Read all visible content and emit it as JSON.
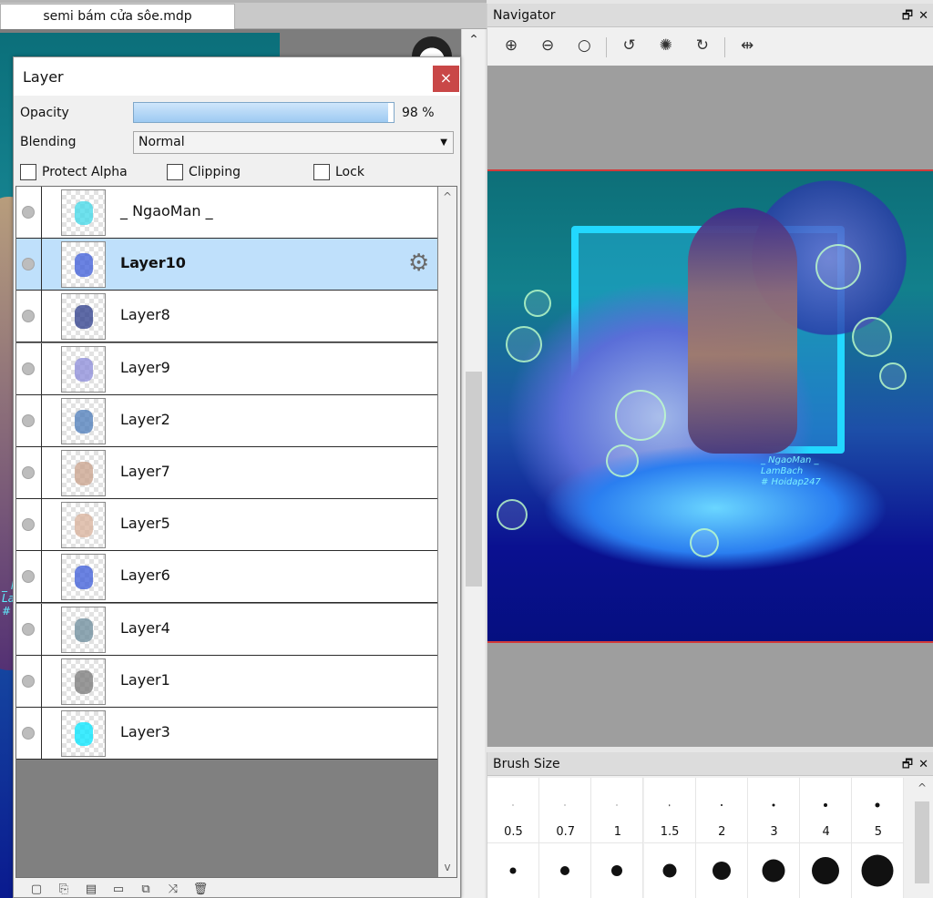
{
  "file_tab": {
    "title": "semi bám cửa sôe.mdp"
  },
  "canvas": {
    "signature": "_ NgaoMan _\nLamBach\n# Hoidap247"
  },
  "layer_panel": {
    "title": "Layer",
    "close_glyph": "×",
    "opacity_label": "Opacity",
    "opacity_value": "98 %",
    "opacity_fraction": 0.98,
    "blending_label": "Blending",
    "blending_value": "Normal",
    "checkboxes": {
      "protect_alpha": "Protect Alpha",
      "clipping": "Clipping",
      "lock": "Lock"
    },
    "layers": [
      {
        "name": "_ NgaoMan _",
        "selected": false,
        "thumb_color": "#3fd8e8"
      },
      {
        "name": "Layer10",
        "selected": true,
        "thumb_color": "#3a5ad8"
      },
      {
        "name": "Layer8",
        "selected": false,
        "thumb_color": "#2a3a8a"
      },
      {
        "name": "Layer9",
        "selected": false,
        "thumb_color": "#8a8ad8"
      },
      {
        "name": "Layer2",
        "selected": false,
        "thumb_color": "#4a7ab8"
      },
      {
        "name": "Layer7",
        "selected": false,
        "thumb_color": "#c8a08a"
      },
      {
        "name": "Layer5",
        "selected": false,
        "thumb_color": "#d8b09a"
      },
      {
        "name": "Layer6",
        "selected": false,
        "thumb_color": "#3a5ad8"
      },
      {
        "name": "Layer4",
        "selected": false,
        "thumb_color": "#6a8a9a"
      },
      {
        "name": "Layer1",
        "selected": false,
        "thumb_color": "#777777"
      },
      {
        "name": "Layer3",
        "selected": false,
        "thumb_color": "#00e5ff"
      }
    ],
    "toolbar_icons": [
      "new-layer-icon",
      "duplicate-layer-icon",
      "new-halftone-layer-icon",
      "new-folder-icon",
      "merge-down-icon",
      "transform-icon",
      "delete-layer-icon"
    ]
  },
  "navigator": {
    "title": "Navigator",
    "toolbar_icons": [
      "zoom-in-icon",
      "zoom-out-icon",
      "zoom-actual-icon",
      "rotate-left-icon",
      "rotate-reset-icon",
      "rotate-right-icon",
      "flip-horizontal-icon"
    ]
  },
  "brush_size": {
    "title": "Brush Size",
    "sizes": [
      {
        "label": "0.5",
        "dot": 0
      },
      {
        "label": "0.7",
        "dot": 0
      },
      {
        "label": "1",
        "dot": 1
      },
      {
        "label": "1.5",
        "dot": 1.5
      },
      {
        "label": "2",
        "dot": 2
      },
      {
        "label": "3",
        "dot": 3
      },
      {
        "label": "4",
        "dot": 4
      },
      {
        "label": "5",
        "dot": 5
      }
    ],
    "sizes_row2": [
      {
        "label": "",
        "dot": 7
      },
      {
        "label": "",
        "dot": 10
      },
      {
        "label": "",
        "dot": 12
      },
      {
        "label": "",
        "dot": 15
      },
      {
        "label": "",
        "dot": 20
      },
      {
        "label": "",
        "dot": 25
      },
      {
        "label": "",
        "dot": 30
      },
      {
        "label": "",
        "dot": 35
      }
    ]
  },
  "colors": {
    "selected_row": "#bfe0fb",
    "close_button": "#c94747",
    "nav_border": "#d23a3a"
  }
}
